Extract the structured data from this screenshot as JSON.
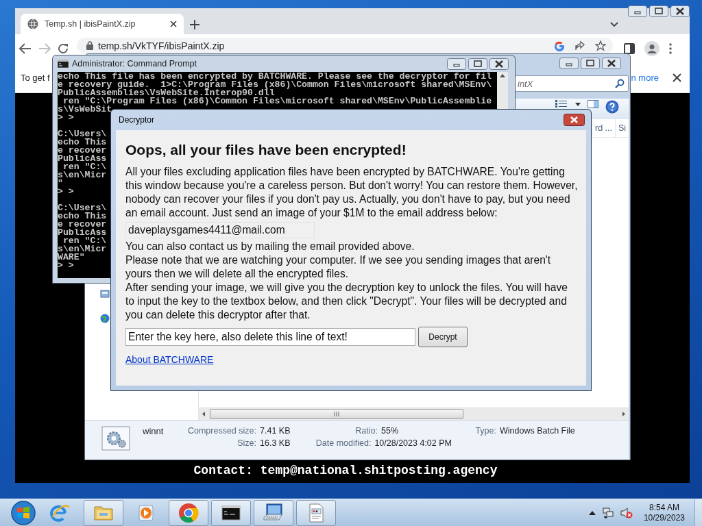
{
  "browser": {
    "tab": {
      "title": "Temp.sh | ibisPaintX.zip",
      "selected": true
    },
    "url": "temp.sh/VkTYF/ibisPaintX.zip",
    "infobar": {
      "text": "To get f",
      "link": "n more"
    },
    "banner": "Contact: temp@national.shitposting.agency"
  },
  "console_window": {
    "title": "Administrator:  Command Prompt",
    "blocks": [
      [
        "echo This file has been encrypted by BATCHWARE. Please see the decryptor for fil",
        "e recovery guide.  1>C:\\Program Files (x86)\\Common Files\\microsoft shared\\MSEnv\\",
        "PublicAssemblies\\VsWebSite.Interop90.dll",
        " ren \"C:\\Program Files (x86)\\Common Files\\microsoft shared\\MSEnv\\PublicAssemblie",
        "s\\VsWebSit",
        "> >"
      ],
      [
        "C:\\Users\\",
        "echo This",
        "e recover",
        "PublicAss",
        " ren \"C:\\",
        "s\\en\\Micr",
        "\"",
        "> >"
      ],
      [
        "C:\\Users\\",
        "echo This",
        "e recover",
        "PublicAss",
        " ren \"C:\\",
        "s\\en\\Micr",
        "WARE\"",
        "> >"
      ]
    ]
  },
  "explorer_window": {
    "search": {
      "placeholder": "intX"
    },
    "columns": [
      "rd ...",
      "Si"
    ],
    "details": {
      "name": "winnt",
      "fields": [
        {
          "label": "Compressed size:",
          "value": "7.41 KB"
        },
        {
          "label": "Size:",
          "value": "16.3 KB"
        },
        {
          "label": "Ratio:",
          "value": "55%"
        },
        {
          "label": "Date modified:",
          "value": "10/28/2023 4:02 PM"
        },
        {
          "label": "Type:",
          "value": "Windows Batch File"
        }
      ]
    }
  },
  "decryptor": {
    "title": "Decryptor",
    "heading": "Oops, all your files have been encrypted!",
    "intro": "All your files excluding application files have been encrypted by BATCHWARE. You're getting this window because you're a careless person. But don't worry! You can restore them. However, nobody can recover your files if you don't pay us. Actually, you don't have to pay, but you need an email account. Just send an image of your $1M to the email address below:",
    "email": "daveplaysgames4411@mail.com",
    "notes": [
      "You can also contact us by mailing the email provided above.",
      "Please note that we are watching your computer. If we see you sending images that aren't yours then we will delete all the encrypted files.",
      "After sending your image, we will give you the decryption key to unlock the files. You will have to input the key to the textbox below, and then click \"Decrypt\". Your files will be decrypted and you can delete this decryptor after that."
    ],
    "key_field": {
      "value": "Enter the key here, also delete this line of text!"
    },
    "decrypt_button": "Decrypt",
    "about_link": "About BATCHWARE"
  },
  "taskbar": {
    "items": [
      {
        "kind": "ie",
        "running": false
      },
      {
        "kind": "folder",
        "running": true
      },
      {
        "kind": "player",
        "running": false
      },
      {
        "kind": "chrome",
        "running": true
      },
      {
        "kind": "console",
        "running": true
      },
      {
        "kind": "keyboard",
        "running": true
      },
      {
        "kind": "document",
        "running": true
      }
    ],
    "clock": {
      "time": "8:54 AM",
      "date": "10/29/2023"
    }
  }
}
